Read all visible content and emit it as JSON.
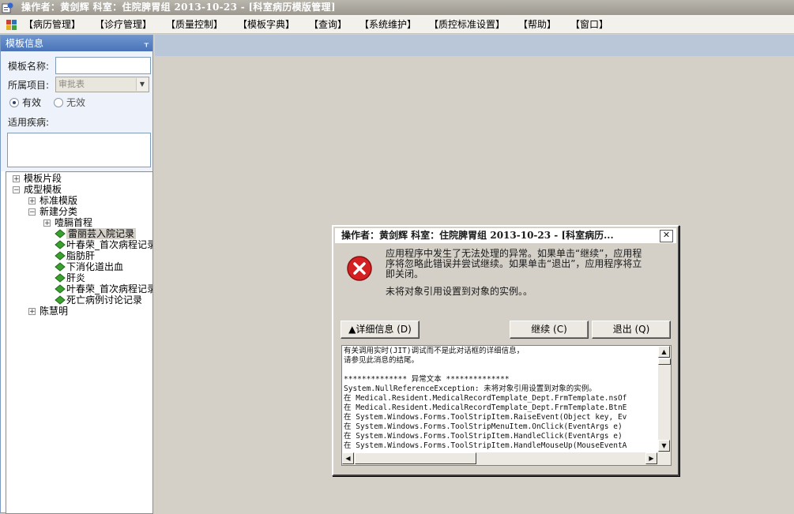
{
  "window": {
    "title": "操作者：黄剑辉   科室：住院脾胃组   2013-10-23 - [科室病历模版管理]",
    "icon": "app-window-icon"
  },
  "menu": {
    "items": [
      "【病历管理】",
      "【诊疗管理】",
      "【质量控制】",
      "【模板字典】",
      "【查询】",
      "【系统维护】",
      "【质控标准设置】",
      "【帮助】",
      "【窗口】"
    ]
  },
  "panel": {
    "title": "模板信息",
    "pin_glyph": "ᚁ",
    "template_name_label": "模板名称:",
    "template_name_value": "",
    "project_label": "所属项目:",
    "project_value": "审批表",
    "status_valid_label": "有效",
    "status_invalid_label": "无效",
    "status_selected": "有效",
    "disease_label": "适用疾病:",
    "disease_value": ""
  },
  "tree": {
    "nodes": [
      {
        "label": "模板片段",
        "expander": "+"
      },
      {
        "label": "成型模板",
        "expander": "−"
      },
      {
        "label": "标准模版",
        "expander": "+"
      },
      {
        "label": "新建分类",
        "expander": "−"
      },
      {
        "label": "噎膈首程",
        "expander": "+"
      },
      {
        "label": "雷丽芸入院记录",
        "selected": true
      },
      {
        "label": "叶春荣_首次病程记录"
      },
      {
        "label": "脂肪肝"
      },
      {
        "label": "下消化道出血"
      },
      {
        "label": "肝炎"
      },
      {
        "label": "叶春荣_首次病程记录"
      },
      {
        "label": "死亡病例讨论记录"
      },
      {
        "label": "陈慧明",
        "expander": "+"
      }
    ]
  },
  "dialog": {
    "title": "操作者：黄剑辉   科室：住院脾胃组   2013-10-23 - [科室病历...",
    "close_glyph": "✕",
    "message_lines": [
      "应用程序中发生了无法处理的异常。如果单击“继续”，应用程",
      "序将忽略此错误并尝试继续。如果单击“退出”，应用程序将立",
      "即关闭。"
    ],
    "error_detail": "未将对象引用设置到对象的实例。。",
    "details_button": "▲详细信息 (D)",
    "continue_button": "继续 (C)",
    "quit_button": "退出 (Q)",
    "details_text": [
      "有关调用实时(JIT)调试而不是此对话框的详细信息，",
      "请参见此消息的结尾。",
      "",
      "************** 异常文本 **************",
      "System.NullReferenceException: 未将对象引用设置到对象的实例。",
      "   在 Medical.Resident.MedicalRecordTemplate_Dept.FrmTemplate.nsOf",
      "   在 Medical.Resident.MedicalRecordTemplate_Dept.FrmTemplate.BtnE",
      "   在 System.Windows.Forms.ToolStripItem.RaiseEvent(Object key, Ev",
      "   在 System.Windows.Forms.ToolStripMenuItem.OnClick(EventArgs e)",
      "   在 System.Windows.Forms.ToolStripItem.HandleClick(EventArgs e)",
      "   在 System.Windows.Forms.ToolStripItem.HandleMouseUp(MouseEventA"
    ]
  },
  "colors": {
    "panel_header": "#4a74b8",
    "error_red": "#d42020",
    "tree_leaf_green": "#3aa02e",
    "desktop_gray": "#d4d0c8"
  }
}
